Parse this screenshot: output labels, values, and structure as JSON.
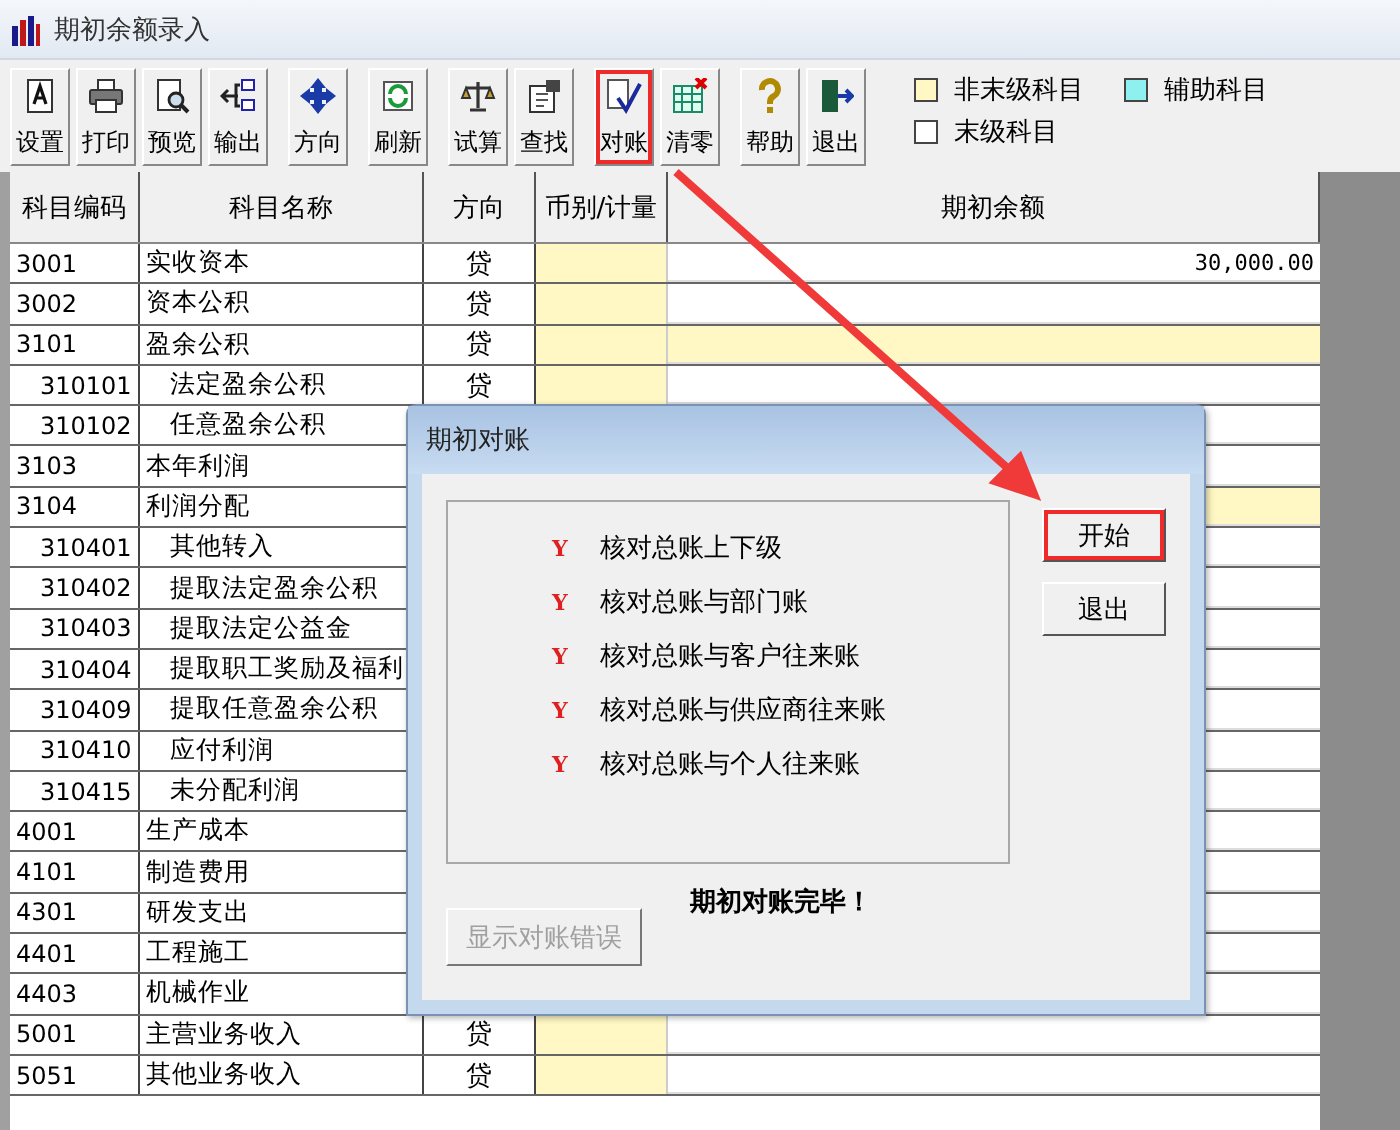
{
  "window": {
    "title": "期初余额录入"
  },
  "toolbar": {
    "groups": [
      [
        {
          "label": "设置",
          "highlighted": false
        },
        {
          "label": "打印",
          "highlighted": false
        },
        {
          "label": "预览",
          "highlighted": false
        },
        {
          "label": "输出",
          "highlighted": false
        }
      ],
      [
        {
          "label": "方向",
          "highlighted": false
        }
      ],
      [
        {
          "label": "刷新",
          "highlighted": false
        }
      ],
      [
        {
          "label": "试算",
          "highlighted": false
        },
        {
          "label": "查找",
          "highlighted": false
        }
      ],
      [
        {
          "label": "对账",
          "highlighted": true
        },
        {
          "label": "清零",
          "highlighted": false
        }
      ],
      [
        {
          "label": "帮助",
          "highlighted": false
        },
        {
          "label": "退出",
          "highlighted": false
        }
      ]
    ]
  },
  "legend": [
    {
      "label": "非末级科目",
      "color": "#fff8c4"
    },
    {
      "label": "辅助科目",
      "color": "#8ff0f0"
    },
    {
      "label": "末级科目",
      "color": "#ffffff"
    }
  ],
  "table": {
    "columns": [
      "科目编码",
      "科目名称",
      "方向",
      "币别/计量",
      "期初余额"
    ],
    "rows": [
      {
        "code": "3001",
        "name": "实收资本",
        "direction": "贷",
        "balance": "30,000.00"
      },
      {
        "code": "3002",
        "name": "资本公积",
        "direction": "贷"
      },
      {
        "code": "3101",
        "name": "盈余公积",
        "direction": "贷",
        "children": [
          {
            "code": "310101",
            "name": "法定盈余公积",
            "direction": "贷"
          },
          {
            "code": "310102",
            "name": "任意盈余公积"
          }
        ]
      },
      {
        "code": "3103",
        "name": "本年利润"
      },
      {
        "code": "3104",
        "name": "利润分配",
        "children": [
          {
            "code": "310401",
            "name": "其他转入"
          },
          {
            "code": "310402",
            "name": "提取法定盈余公积"
          },
          {
            "code": "310403",
            "name": "提取法定公益金"
          },
          {
            "code": "310404",
            "name": "提取职工奖励及福利"
          },
          {
            "code": "310409",
            "name": "提取任意盈余公积"
          },
          {
            "code": "310410",
            "name": "应付利润"
          },
          {
            "code": "310415",
            "name": "未分配利润"
          }
        ]
      },
      {
        "code": "4001",
        "name": "生产成本"
      },
      {
        "code": "4101",
        "name": "制造费用"
      },
      {
        "code": "4301",
        "name": "研发支出"
      },
      {
        "code": "4401",
        "name": "工程施工"
      },
      {
        "code": "4403",
        "name": "机械作业"
      },
      {
        "code": "5001",
        "name": "主营业务收入",
        "direction": "贷"
      },
      {
        "code": "5051",
        "name": "其他业务收入",
        "direction": "贷"
      }
    ]
  },
  "dialog": {
    "title": "期初对账",
    "checks": [
      {
        "mark": "Y",
        "label": "核对总账上下级"
      },
      {
        "mark": "Y",
        "label": "核对总账与部门账"
      },
      {
        "mark": "Y",
        "label": "核对总账与客户往来账"
      },
      {
        "mark": "Y",
        "label": "核对总账与供应商往来账"
      },
      {
        "mark": "Y",
        "label": "核对总账与个人往来账"
      }
    ],
    "buttons": [
      {
        "label": "开始",
        "highlighted": true
      },
      {
        "label": "退出",
        "highlighted": false
      }
    ],
    "status": "期初对账完毕！",
    "error_button": {
      "label": "显示对账错误",
      "disabled": true
    }
  }
}
